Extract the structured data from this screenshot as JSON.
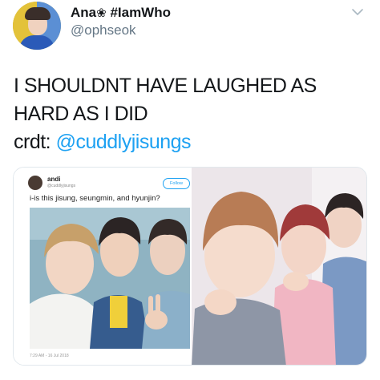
{
  "author": {
    "display_name": "Ana",
    "name_emoji": "❀",
    "hashtag": "#IamWho",
    "handle": "@ophseok"
  },
  "tweet": {
    "line1": "I SHOULDNT HAVE LAUGHED AS",
    "line2": "HARD AS I DID",
    "credit_prefix": "crdt: ",
    "credit_mention": "@cuddlyjisungs"
  },
  "embedded_tweet": {
    "display_name": "andi",
    "handle": "@cuddlyjisungs",
    "follow_label": "Follow",
    "text": "i-is this jisung, seungmin, and hyunjin?",
    "timestamp": "7:29 AM - 16 Jul 2018"
  },
  "icons": {
    "menu": "chevron-down-icon"
  },
  "colors": {
    "link": "#1da1f2",
    "secondary_text": "#657786",
    "primary_text": "#14171a"
  }
}
